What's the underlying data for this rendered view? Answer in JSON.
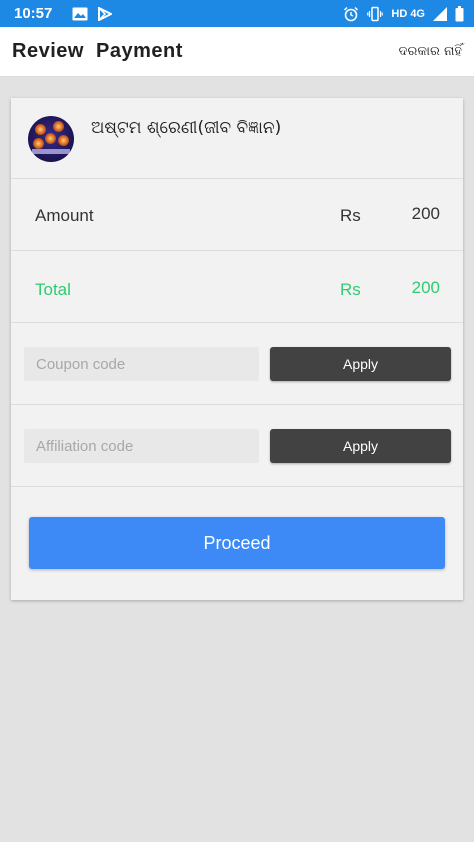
{
  "status_bar": {
    "time": "10:57",
    "network_label": "HD 4G",
    "icons": [
      "image-icon",
      "play-store-icon",
      "alarm-icon",
      "vibrate-icon",
      "signal-icon",
      "battery-icon"
    ]
  },
  "header": {
    "title": "Review  Payment",
    "action_label": "ଦରକାର ନାହିଁ"
  },
  "course": {
    "name": "ଅଷ୍ଟମ ଶ୍ରେଣୀ(ଜୀବ ବିଜ୍ଞାନ)",
    "thumbnail_icon": "course-thumbnail"
  },
  "amount": {
    "label": "Amount",
    "currency": "Rs",
    "value": "200"
  },
  "total": {
    "label": "Total",
    "currency": "Rs",
    "value": "200"
  },
  "coupon": {
    "placeholder": "Coupon code",
    "value": "",
    "button_label": "Apply"
  },
  "affiliation": {
    "placeholder": "Affiliation code",
    "value": "",
    "button_label": "Apply"
  },
  "proceed_label": "Proceed",
  "colors": {
    "status_bar": "#1e88e5",
    "total_green": "#2ecc71",
    "apply_button": "#424242",
    "proceed_button": "#3d8af7",
    "background": "#e2e2e2",
    "card": "#f2f2f2"
  }
}
